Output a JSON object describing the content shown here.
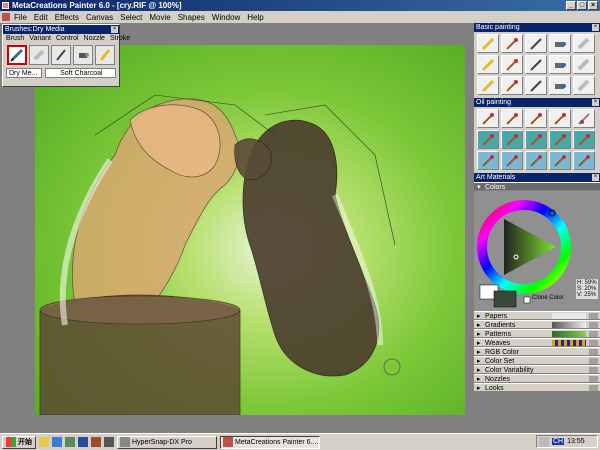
{
  "window": {
    "title": "MetaCreations Painter 6.0 - [cry.RIF @ 100%]"
  },
  "menu": [
    "File",
    "Edit",
    "Effects",
    "Canvas",
    "Select",
    "Movie",
    "Shapes",
    "Window",
    "Help"
  ],
  "brushes_palette": {
    "title": "Brushes:Dry Media",
    "tabs": [
      "Brush",
      "Variant",
      "Control",
      "Nozzle",
      "Stroke"
    ],
    "icons": [
      "pencil-icon",
      "eraser-icon",
      "pen-icon",
      "airbrush-icon",
      "marker-icon"
    ],
    "category": "Dry Me...",
    "variant": "Soft Charcoal"
  },
  "basic_painting": {
    "title": "Basic painting",
    "icons": [
      "pencil-icon",
      "brush-icon",
      "pen-icon",
      "airbrush-icon",
      "eraser-icon",
      "pencil-icon",
      "brush-icon",
      "pen-icon",
      "airbrush-icon",
      "eraser-icon",
      "pencil-icon",
      "brush-icon",
      "pen-icon",
      "airbrush-icon",
      "eraser-icon"
    ]
  },
  "oil_painting": {
    "title": "Oil painting",
    "icons": [
      "brush-icon",
      "brush-icon",
      "brush-icon",
      "brush-icon",
      "knife-icon",
      "brush-icon",
      "brush-icon",
      "brush-icon",
      "brush-icon",
      "brush-icon",
      "brush-icon",
      "brush-icon",
      "brush-icon",
      "brush-icon",
      "brush-icon"
    ]
  },
  "art_materials": {
    "title": "Art Materials",
    "colors_label": "Colors",
    "hsv": {
      "h": "H: 59%",
      "s": "S: 20%",
      "v": "V: 25%"
    },
    "clone_color": "Clone Color",
    "sections": [
      "Papers",
      "Gradients",
      "Patterns",
      "Weaves",
      "RGB Color",
      "Color Set",
      "Color Variability",
      "Nozzles",
      "Looks"
    ]
  },
  "taskbar": {
    "start": "开始",
    "tasks": [
      "HyperSnap-DX Pro",
      "MetaCreations Painter 6...."
    ],
    "clock": "13:55",
    "tray": "CH"
  },
  "colors": {
    "titlebar": "#0a246a",
    "panel_bg": "#d4d0c8",
    "primary_swatch": "#ffffff",
    "secondary_swatch": "#3a4a3a"
  }
}
